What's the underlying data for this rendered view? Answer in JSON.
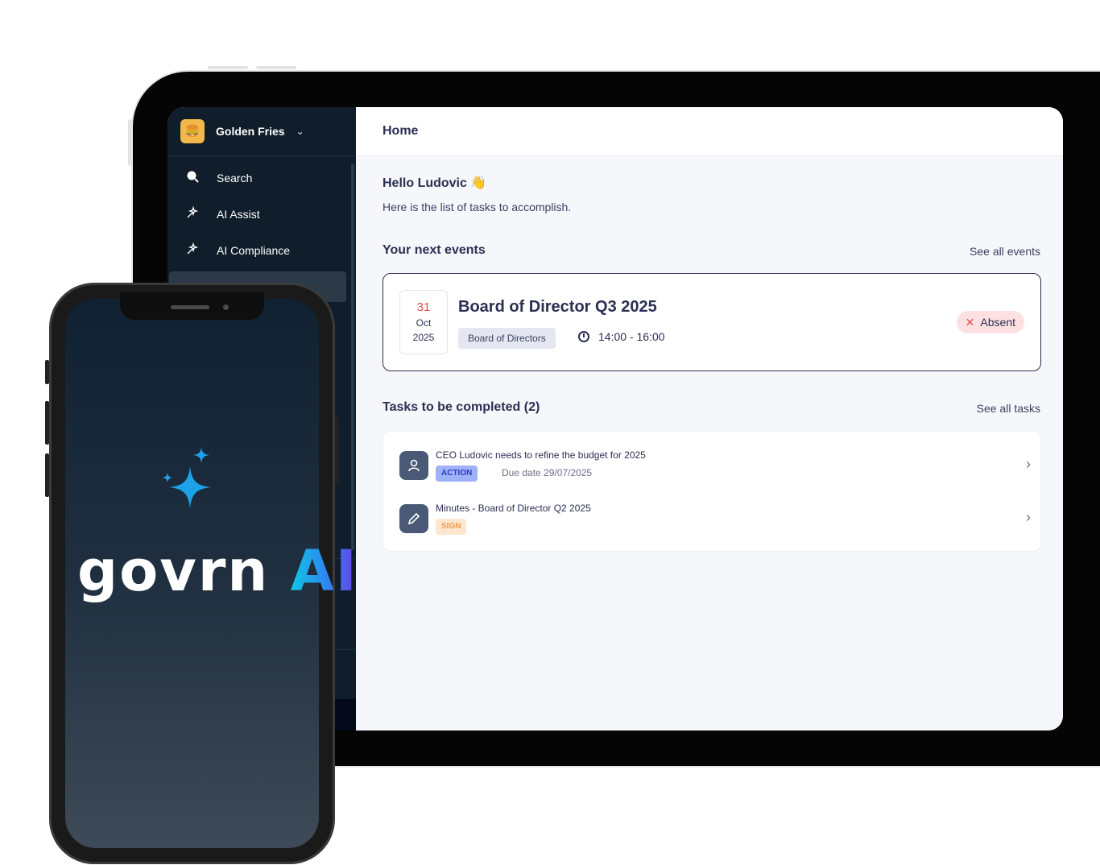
{
  "sidebar": {
    "org_name": "Golden Fries",
    "org_logo_glyph": "🍔",
    "items": [
      {
        "label": "Search",
        "icon": "search-icon"
      },
      {
        "label": "AI Assist",
        "icon": "magic-wand-icon"
      },
      {
        "label": "AI Compliance",
        "icon": "magic-wand-icon"
      },
      {
        "label": "",
        "icon": "home-icon"
      }
    ]
  },
  "header": {
    "title": "Home"
  },
  "greeting": {
    "hello": "Hello Ludovic 👋",
    "subtitle": "Here is the list of tasks to accomplish."
  },
  "events": {
    "section_title": "Your next events",
    "see_all": "See all events",
    "items": [
      {
        "day": "31",
        "month": "Oct",
        "year": "2025",
        "title": "Board of Director Q3 2025",
        "tag": "Board of Directors",
        "time": "14:00 - 16:00",
        "status": "Absent"
      }
    ]
  },
  "tasks": {
    "section_title": "Tasks to be completed (2)",
    "see_all": "See all tasks",
    "items": [
      {
        "text": "CEO Ludovic needs to refine the budget for 2025",
        "badge": "ACTION",
        "due": "Due date 29/07/2025",
        "icon": "user-icon"
      },
      {
        "text": "Minutes - Board of Director Q2 2025",
        "badge": "SIGN",
        "due": "",
        "icon": "pencil-icon"
      }
    ]
  },
  "phone": {
    "brand": "govrn",
    "brand_ai": "AI"
  },
  "colors": {
    "sidebar": "#0f1e2a",
    "accent_red": "#e5484d",
    "action_badge": "#9fb1f7",
    "sign_badge": "#fde6cf",
    "sparkle": "#1da1e8"
  }
}
